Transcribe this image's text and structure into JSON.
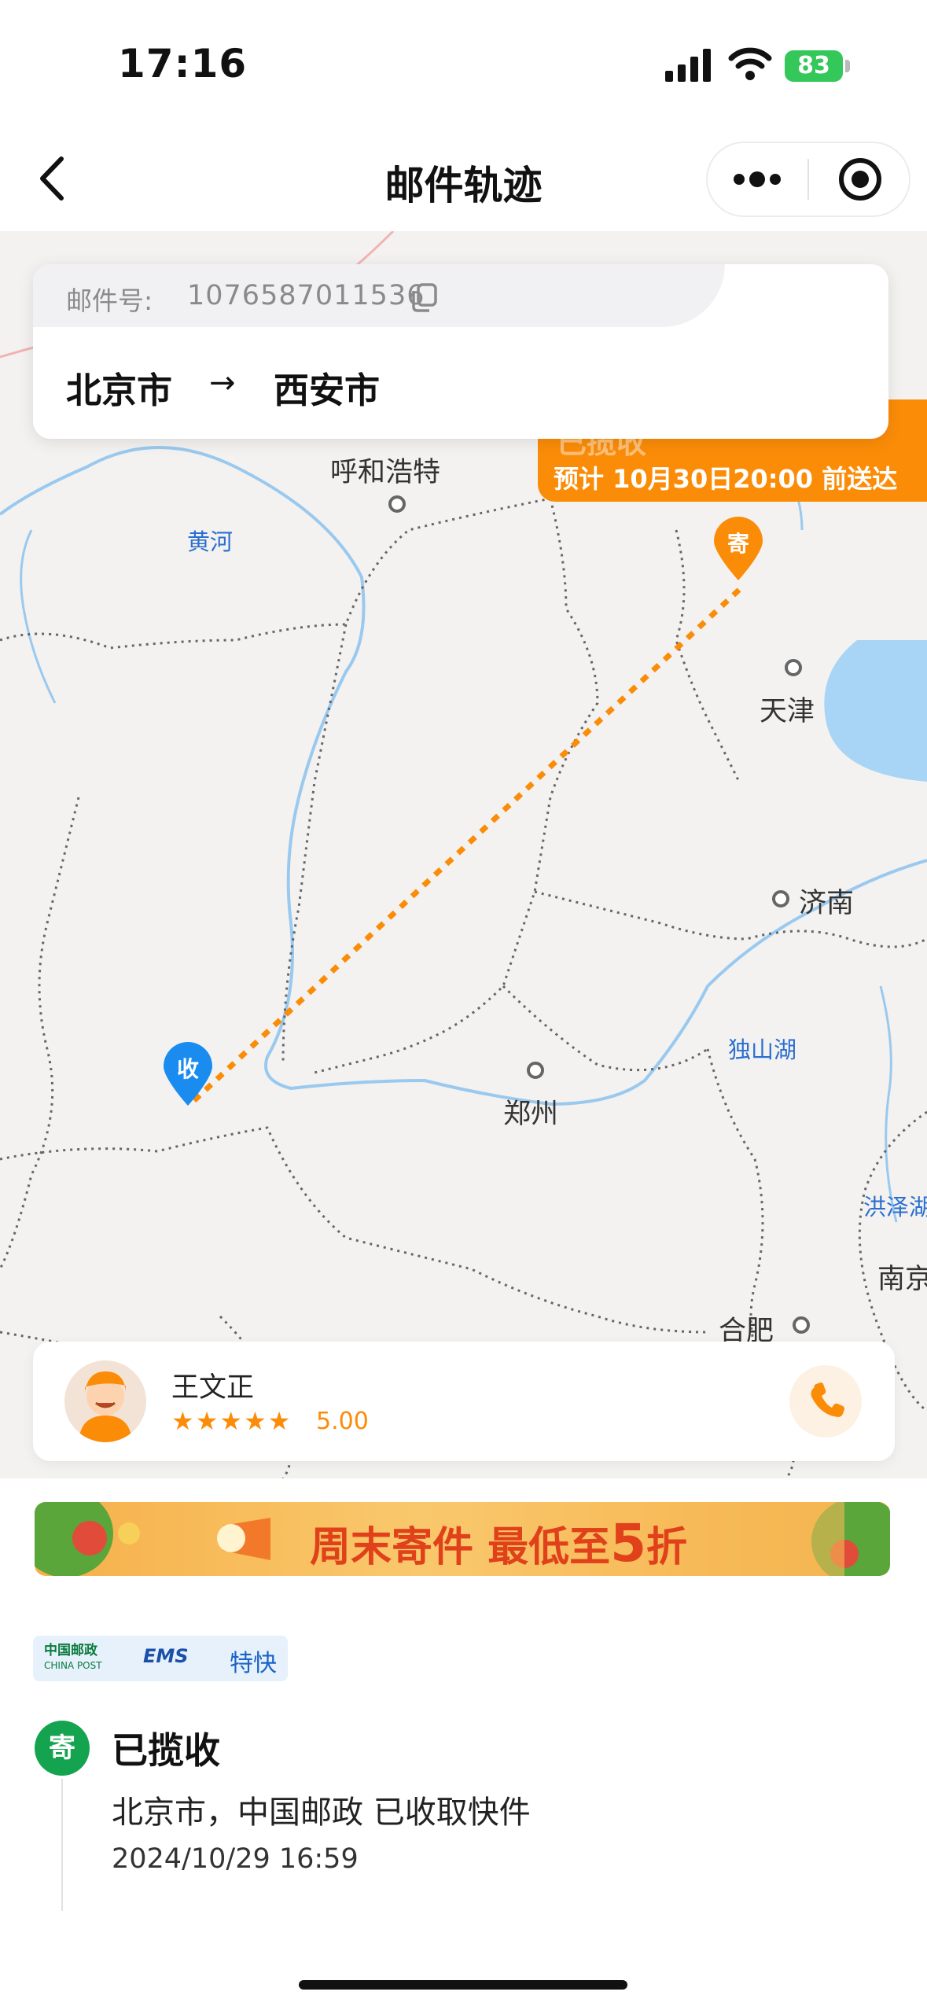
{
  "status_bar": {
    "time": "17:16",
    "battery": "83"
  },
  "nav": {
    "title": "邮件轨迹"
  },
  "mail_card": {
    "number_label": "邮件号:",
    "number": "1076587011536",
    "from": "北京市",
    "arrow": "→",
    "to": "西安市"
  },
  "status_tag": {
    "title": "已揽收",
    "eta": "预计 10月30日20:00 前送达"
  },
  "map": {
    "labels": [
      "呼和浩特",
      "黄河",
      "天津",
      "济南",
      "独山湖",
      "郑州",
      "洪泽湖",
      "南京",
      "合肥"
    ],
    "sender_marker": "寄",
    "receiver_marker": "收"
  },
  "courier": {
    "name": "王文正",
    "stars": "★★★★★",
    "rating": "5.00"
  },
  "banner": {
    "text_part1": "周末寄件 最低至",
    "text_big": "5",
    "text_part2": "折"
  },
  "carrier": {
    "china_post": "中国邮政",
    "china_post_en": "CHINA POST",
    "ems": "EMS",
    "service": "特快"
  },
  "timeline": {
    "icon": "寄",
    "status": "已揽收",
    "description": "北京市，中国邮政 已收取快件",
    "time": "2024/10/29 16:59"
  },
  "colors": {
    "accent": "#fb8c08",
    "route": "#fb8c08",
    "green": "#14a34f",
    "blue_marker": "#1a8cf0"
  }
}
